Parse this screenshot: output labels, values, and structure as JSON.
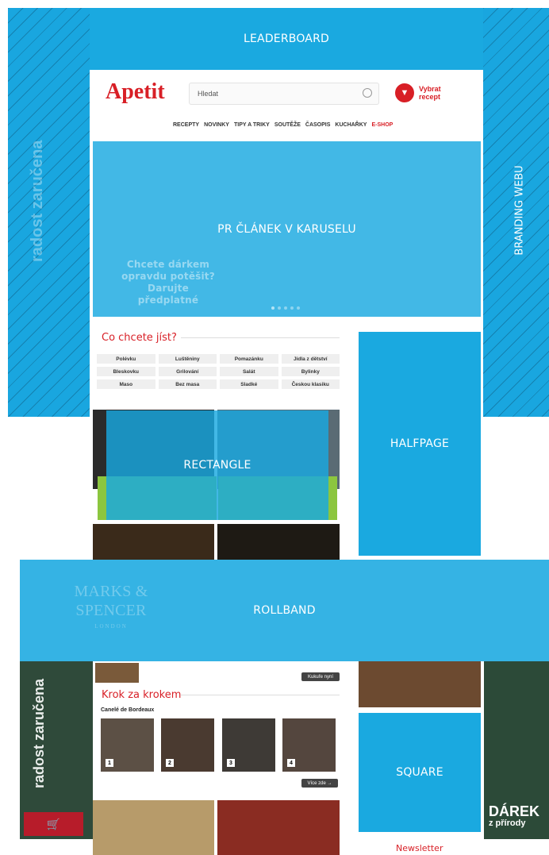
{
  "ads": {
    "leaderboard": "LEADERBOARD",
    "branding": "BRANDING WEBU",
    "carousel": "PR ČLÁNEK V KARUSELU",
    "halfpage": "HALFPAGE",
    "rectangle": "RECTANGLE",
    "rollband": "ROLLBAND",
    "square": "SQUARE"
  },
  "header": {
    "logo": "Apetit",
    "search_placeholder": "Hledat",
    "recipe_button": "Vybrat recept"
  },
  "nav": [
    "RECEPTY",
    "NOVINKY",
    "TIPY A TRIKY",
    "SOUTĚŽE",
    "ČASOPIS",
    "KUCHAŘKY",
    "E-SHOP"
  ],
  "carousel": {
    "promo_lines": [
      "Chcete dárkem",
      "opravdu potěšit?",
      "Darujte předplatné"
    ]
  },
  "what_to_eat": {
    "title": "Co chcete jíst?",
    "categories": [
      "Polévku",
      "Luštěniny",
      "Pomazánku",
      "Jídla z dětství",
      "Bleskovku",
      "Grilování",
      "Salát",
      "Bylinky",
      "Maso",
      "Bez masa",
      "Sladké",
      "Českou klasiku"
    ]
  },
  "rollband_bg": {
    "brand": "MARKS & SPENCER",
    "sub": "LONDON"
  },
  "step_by_step": {
    "title": "Krok za krokem",
    "subtitle": "Canelé de Bordeaux",
    "steps": [
      "1",
      "2",
      "3",
      "4"
    ],
    "more": "Více zde →",
    "prev_button": "Kukuře nyní"
  },
  "newsletter": "Newsletter",
  "side": {
    "left_text": "radost zaručena",
    "right_text": "DÁREK",
    "right_sub": "z přírody"
  },
  "colors": {
    "ad": "#1aa9e0",
    "brand_red": "#d81f26"
  }
}
